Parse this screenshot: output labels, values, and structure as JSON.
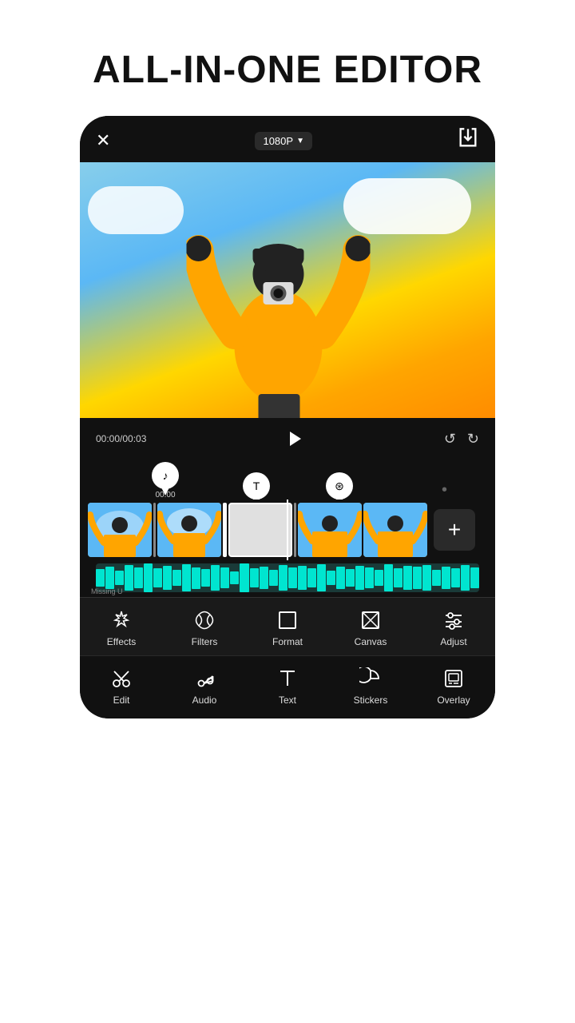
{
  "page": {
    "title": "ALL-IN-ONE EDITOR"
  },
  "topbar": {
    "close_label": "✕",
    "resolution": "1080P",
    "resolution_chevron": "▼",
    "export_icon": "export"
  },
  "video": {
    "timestamp": "00:00/00:03"
  },
  "pins": [
    {
      "icon": "♪",
      "time": "00:00"
    },
    {
      "icon": "T",
      "time": ""
    },
    {
      "icon": "⊛",
      "time": ""
    }
  ],
  "timeline": {
    "add_label": "+"
  },
  "waveform": {
    "label": "Missing U"
  },
  "toolbar_effects": {
    "items": [
      {
        "id": "effects",
        "label": "Effects",
        "icon_type": "star"
      },
      {
        "id": "filters",
        "label": "Filters",
        "icon_type": "clover"
      },
      {
        "id": "format",
        "label": "Format",
        "icon_type": "square"
      },
      {
        "id": "canvas",
        "label": "Canvas",
        "icon_type": "diagonal-square"
      },
      {
        "id": "adjust",
        "label": "Adjust",
        "icon_type": "sliders"
      }
    ]
  },
  "toolbar_edit": {
    "items": [
      {
        "id": "edit",
        "label": "Edit",
        "icon_type": "scissors"
      },
      {
        "id": "audio",
        "label": "Audio",
        "icon_type": "music-note"
      },
      {
        "id": "text",
        "label": "Text",
        "icon_type": "text-t"
      },
      {
        "id": "stickers",
        "label": "Stickers",
        "icon_type": "circle-half"
      },
      {
        "id": "overlay",
        "label": "Overlay",
        "icon_type": "image-frame"
      }
    ]
  }
}
